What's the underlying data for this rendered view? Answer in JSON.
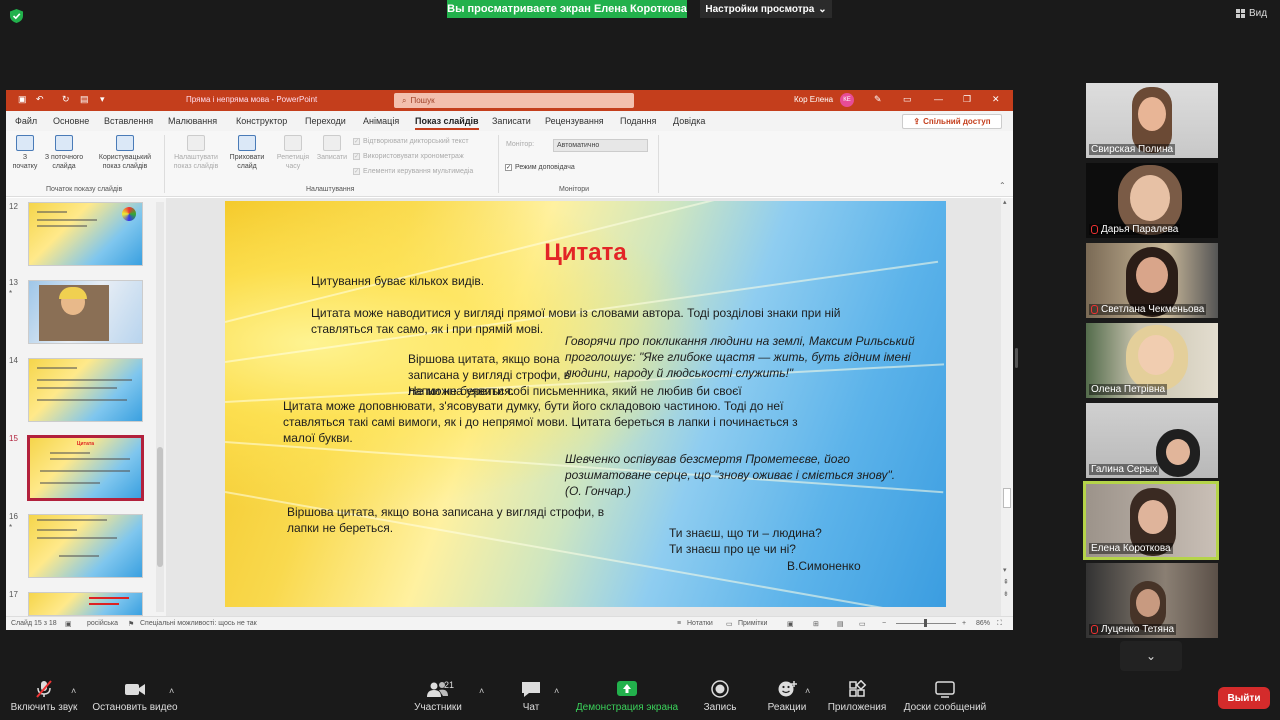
{
  "zoom": {
    "banner": "Вы просматриваете экран Елена Короткова",
    "view_settings": "Настройки просмотра",
    "view_label": "Вид",
    "leave": "Выйти",
    "toolbar": {
      "mute": "Включить звук",
      "video": "Остановить видео",
      "participants": "Участники",
      "participants_count": "21",
      "chat": "Чат",
      "share": "Демонстрация экрана",
      "record": "Запись",
      "reactions": "Реакции",
      "apps": "Приложения",
      "whiteboards": "Доски сообщений"
    },
    "participants_list": [
      {
        "name": "Свирская Полина",
        "muted": false
      },
      {
        "name": "Дарья Паралева",
        "muted": true
      },
      {
        "name": "Светлана Чекменьова",
        "muted": true
      },
      {
        "name": "Олена  Петрівна",
        "muted": false
      },
      {
        "name": "Галина Серых",
        "muted": false
      },
      {
        "name": "Елена Короткова",
        "muted": false
      },
      {
        "name": "Луценко Тетяна",
        "muted": true
      }
    ]
  },
  "ppt": {
    "title": "Пряма і непряма мова  -  PowerPoint",
    "search_placeholder": "Пошук",
    "user": "Кор Елена",
    "user_initials": "КЕ",
    "tabs": [
      "Файл",
      "Основне",
      "Вставлення",
      "Малювання",
      "Конструктор",
      "Переходи",
      "Анімація",
      "Показ слайдів",
      "Записати",
      "Рецензування",
      "Подання",
      "Довідка"
    ],
    "active_tab": "Показ слайдів",
    "share": "Спільний доступ",
    "ribbon": {
      "from_start": "З початку",
      "from_current": "З поточного слайда",
      "custom_show": "Користувацький показ слайдів",
      "group_start": "Початок показу слайдів",
      "setup_show": "Налаштувати показ слайдів",
      "hide_slide": "Приховати слайд",
      "rehearse": "Репетиція часу",
      "record": "Записати",
      "play_narrations": "Відтворювати дикторський текст",
      "use_timings": "Використовувати хронометраж",
      "show_media": "Елементи керування мультимедіа",
      "group_setup": "Налаштування",
      "monitor_label": "Монітор:",
      "monitor_value": "Автоматично",
      "presenter_view": "Режим доповідача",
      "group_monitors": "Монітори"
    },
    "thumb_numbers": [
      "12",
      "13",
      "14",
      "15",
      "16",
      "17"
    ],
    "thumb_mini_title": "Цитата",
    "slide": {
      "title": "Цитата",
      "p1": "Цитування буває кількох видів.",
      "p2": "Цитата може наводитися у вигляді прямої мови із словами автора. Тоді розділові знаки при ній ставляться так само, як і при прямій мові.",
      "p3": "Говорячи про покликання людини на землі, Максим Рильський проголошує: \"Яке глибоке щастя — жить, буть гідним імені людини, народу й людськості служить!\"",
      "p4": "Віршова цитата, якщо вона записана у вигляді строфи, в лапки не береться.",
      "p5": "Не можна уявити собі письменника, який не любив би своєї",
      "p6": "Цитата може доповнювати, з'ясовувати думку, бути його складовою частиною. Тоді до неї ставляться такі самі вимоги, як і до непрямої мови. Цитата береться в лапки і починається з малої букви.",
      "p7": "Шевченко оспівував безсмертя Прометеєве, його розшматоване серце, що \"знову оживає і сміється знову\". (О. Гончар.)",
      "p8": "Віршова цитата, якщо вона записана у вигляді строфи, в лапки не береться.",
      "p9a": "Ти знаєш, що ти – людина?",
      "p9b": "Ти знаєш про це чи ні?",
      "p9c": "В.Симоненко"
    },
    "status": {
      "slide": "Слайд 15 з 18",
      "lang": "російська",
      "access": "Спеціальні можливості: щось не так",
      "notes": "Нотатки",
      "comments": "Примітки",
      "zoom": "86%"
    }
  }
}
